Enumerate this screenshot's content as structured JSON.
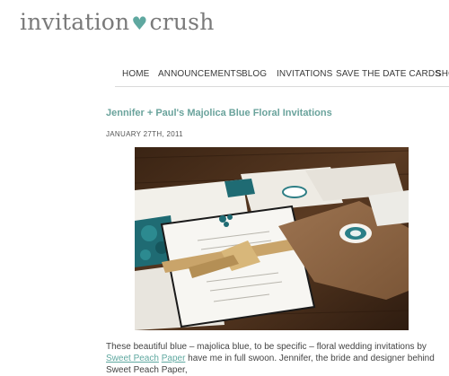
{
  "site": {
    "logo_left": "invitation",
    "logo_right": "crush",
    "logo_icon": "heart-icon",
    "accent_color": "#5fa8a0"
  },
  "nav": {
    "items": [
      {
        "label": "HOME"
      },
      {
        "label": "ANNOUNCEMENTS"
      },
      {
        "label": "BLOG"
      },
      {
        "label": "INVITATIONS"
      },
      {
        "label": "SAVE THE DATE CARDS"
      },
      {
        "label": "SHO"
      }
    ]
  },
  "post": {
    "title": "Jennifer + Paul's Majolica Blue Floral Invitations",
    "date": "JANUARY 27TH, 2011",
    "photo_icon": "wedding-invitation-suite-photo",
    "body_prefix": "These beautiful blue – majolica blue, to be specific – floral wedding invitations by ",
    "body_link_part1": "Sweet Peach",
    "body_link_part2": "Paper",
    "body_suffix": " have me in full swoon.  Jennifer, the bride and designer behind Sweet Peach Paper,"
  }
}
